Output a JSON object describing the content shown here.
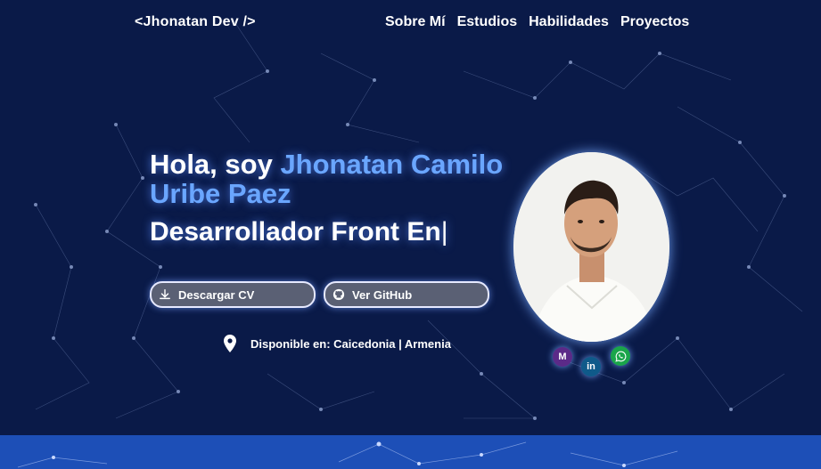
{
  "nav": {
    "logo": "<Jhonatan Dev />",
    "links": [
      "Sobre Mí",
      "Estudios",
      "Habilidades",
      "Proyectos"
    ]
  },
  "hero": {
    "greeting": "Hola, soy ",
    "name": "Jhonatan Camilo Uribe Paez",
    "role": "Desarrollador Front En",
    "cursor": "|"
  },
  "buttons": {
    "cv": "Descargar CV",
    "github": "Ver GitHub"
  },
  "location": "Disponible en: Caicedonia | Armenia",
  "social": {
    "m": "M",
    "linkedin": "in"
  },
  "colors": {
    "background": "#0a1a48",
    "accent": "#6aa6ff",
    "band": "#1d4fb7"
  }
}
